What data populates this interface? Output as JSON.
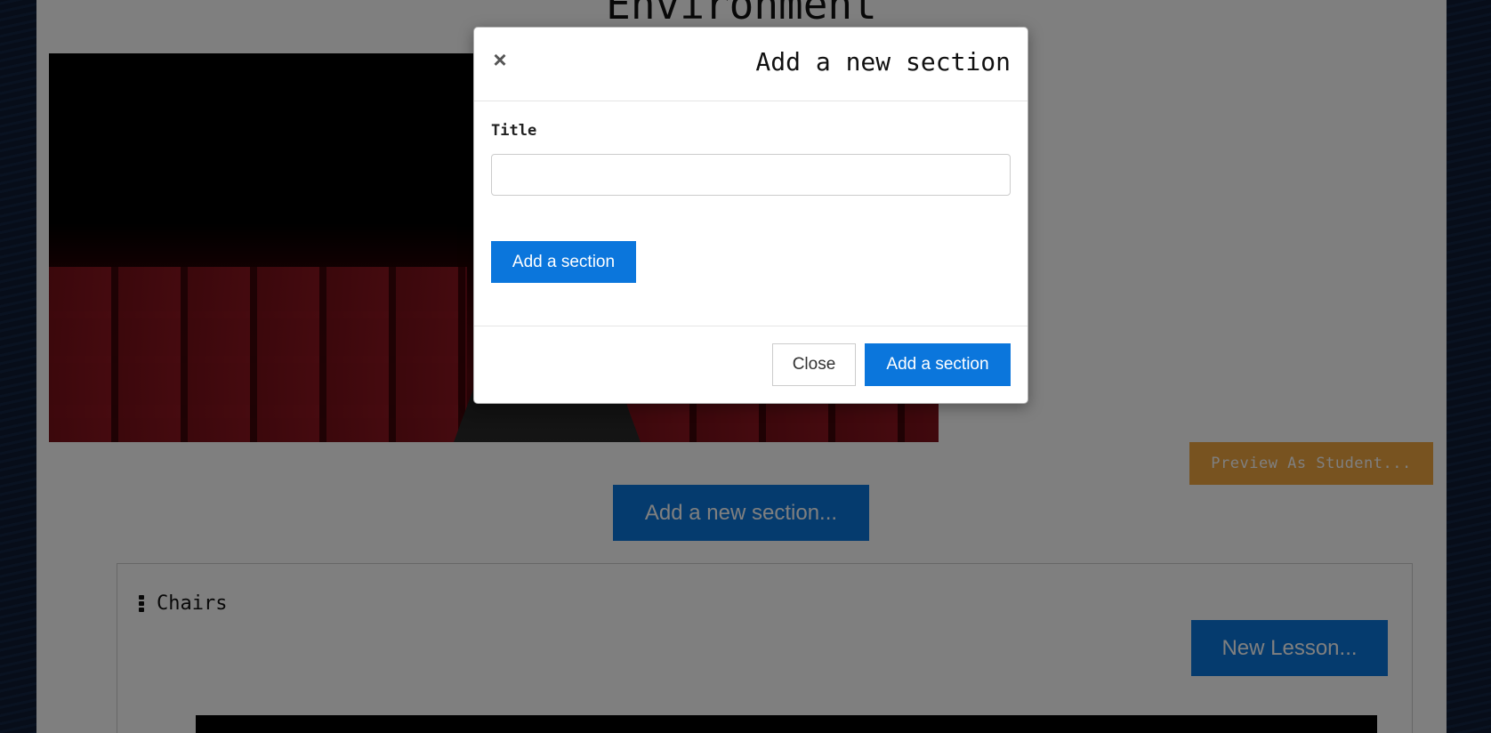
{
  "page": {
    "title": "Environment",
    "preview_label": "Preview As Student...",
    "add_section_label": "Add a new section..."
  },
  "section": {
    "title": "Chairs",
    "new_lesson_label": "New Lesson..."
  },
  "modal": {
    "close_icon": "×",
    "title": "Add a new section",
    "field_label": "Title",
    "field_value": "",
    "field_placeholder": "",
    "submit_label": "Add a section",
    "close_label": "Close",
    "footer_submit_label": "Add a section"
  },
  "colors": {
    "primary": "#0b76dc",
    "warning": "#f0a640",
    "background": "#0e1b33"
  }
}
